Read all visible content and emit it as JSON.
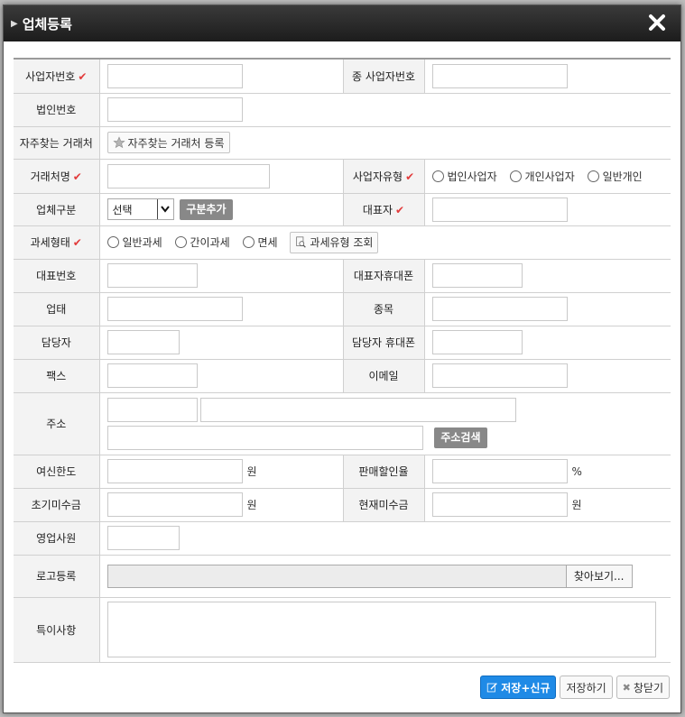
{
  "dialog": {
    "title": "업체등록"
  },
  "rows": {
    "biz_no": {
      "label": "사업자번호",
      "check": "✔"
    },
    "sub_biz_no": {
      "label": "종 사업자번호"
    },
    "corp_no": {
      "label": "법인번호"
    },
    "frequent": {
      "label": "자주찾는 거래처",
      "button": "자주찾는 거래처 등록"
    },
    "client_name": {
      "label": "거래처명",
      "check": "✔"
    },
    "biz_type": {
      "label": "사업자유형",
      "check": "✔",
      "options": [
        "법인사업자",
        "개인사업자",
        "일반개인"
      ]
    },
    "category": {
      "label": "업체구분",
      "selected": "선택",
      "add_button": "구분추가"
    },
    "ceo": {
      "label": "대표자",
      "check": "✔"
    },
    "tax_type": {
      "label": "과세형태",
      "check": "✔",
      "options": [
        "일반과세",
        "간이과세",
        "면세"
      ],
      "lookup_button": "과세유형 조회"
    },
    "main_phone": {
      "label": "대표번호"
    },
    "ceo_mobile": {
      "label": "대표자휴대폰"
    },
    "business": {
      "label": "업태"
    },
    "item": {
      "label": "종목"
    },
    "manager": {
      "label": "담당자"
    },
    "manager_mobile": {
      "label": "담당자 휴대폰"
    },
    "fax": {
      "label": "팩스"
    },
    "email": {
      "label": "이메일"
    },
    "address": {
      "label": "주소",
      "search_button": "주소검색"
    },
    "credit_limit": {
      "label": "여신한도",
      "unit": "원"
    },
    "discount_rate": {
      "label": "판매할인율",
      "unit": "%"
    },
    "initial_receivable": {
      "label": "초기미수금",
      "unit": "원"
    },
    "current_receivable": {
      "label": "현재미수금",
      "unit": "원"
    },
    "sales_rep": {
      "label": "영업사원"
    },
    "logo": {
      "label": "로고등록",
      "browse_button": "찾아보기..."
    },
    "notes": {
      "label": "특이사항"
    }
  },
  "footer": {
    "save_new": "저장+신규",
    "save": "저장하기",
    "close": "창닫기"
  },
  "colors": {
    "check": "#e23b3b",
    "primary": "#1f8ae6",
    "gray_button": "#888888"
  }
}
